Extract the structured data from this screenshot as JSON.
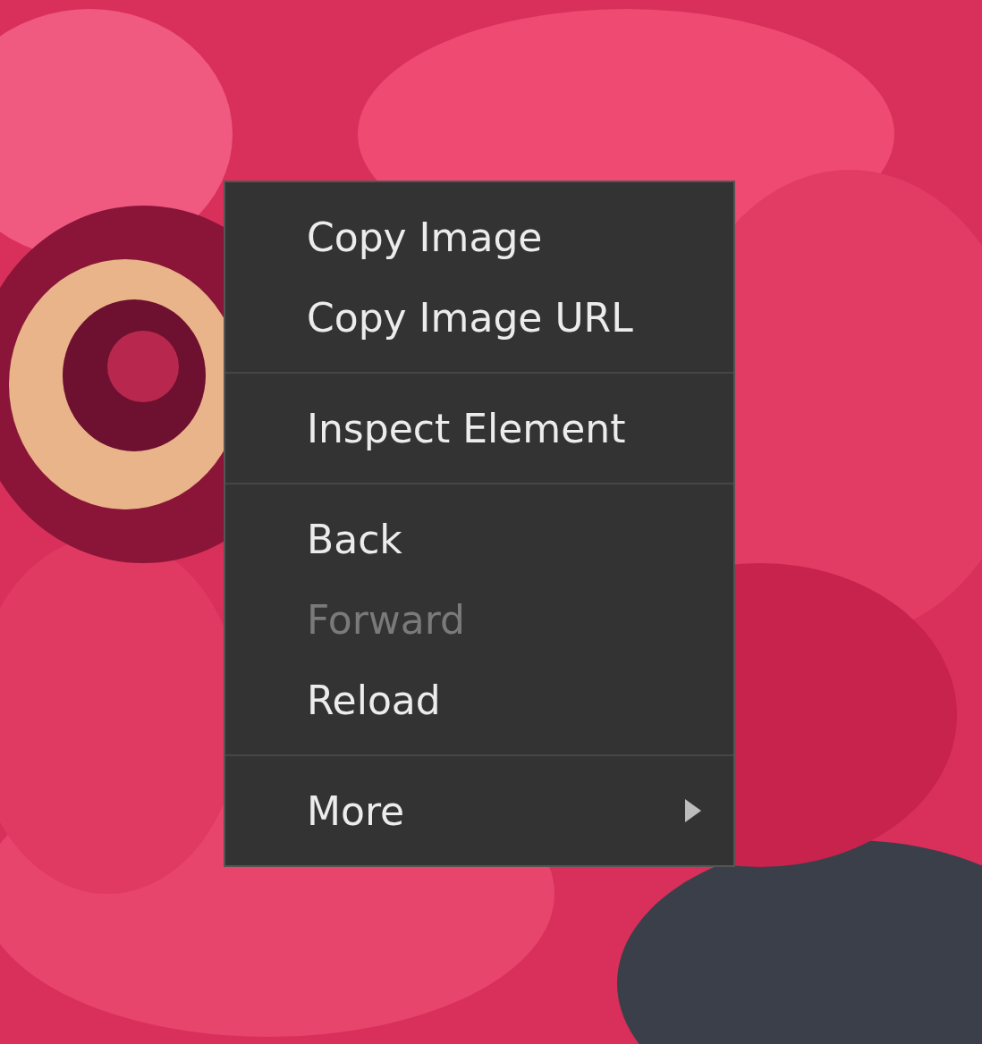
{
  "context_menu": {
    "items": [
      {
        "kind": "item",
        "label": "Copy Image",
        "disabled": false,
        "submenu": false
      },
      {
        "kind": "item",
        "label": "Copy Image URL",
        "disabled": false,
        "submenu": false
      },
      {
        "kind": "separator"
      },
      {
        "kind": "item",
        "label": "Inspect Element",
        "disabled": false,
        "submenu": false
      },
      {
        "kind": "separator"
      },
      {
        "kind": "item",
        "label": "Back",
        "disabled": false,
        "submenu": false
      },
      {
        "kind": "item",
        "label": "Forward",
        "disabled": true,
        "submenu": false
      },
      {
        "kind": "item",
        "label": "Reload",
        "disabled": false,
        "submenu": false
      },
      {
        "kind": "separator"
      },
      {
        "kind": "item",
        "label": "More",
        "disabled": false,
        "submenu": true
      }
    ]
  }
}
